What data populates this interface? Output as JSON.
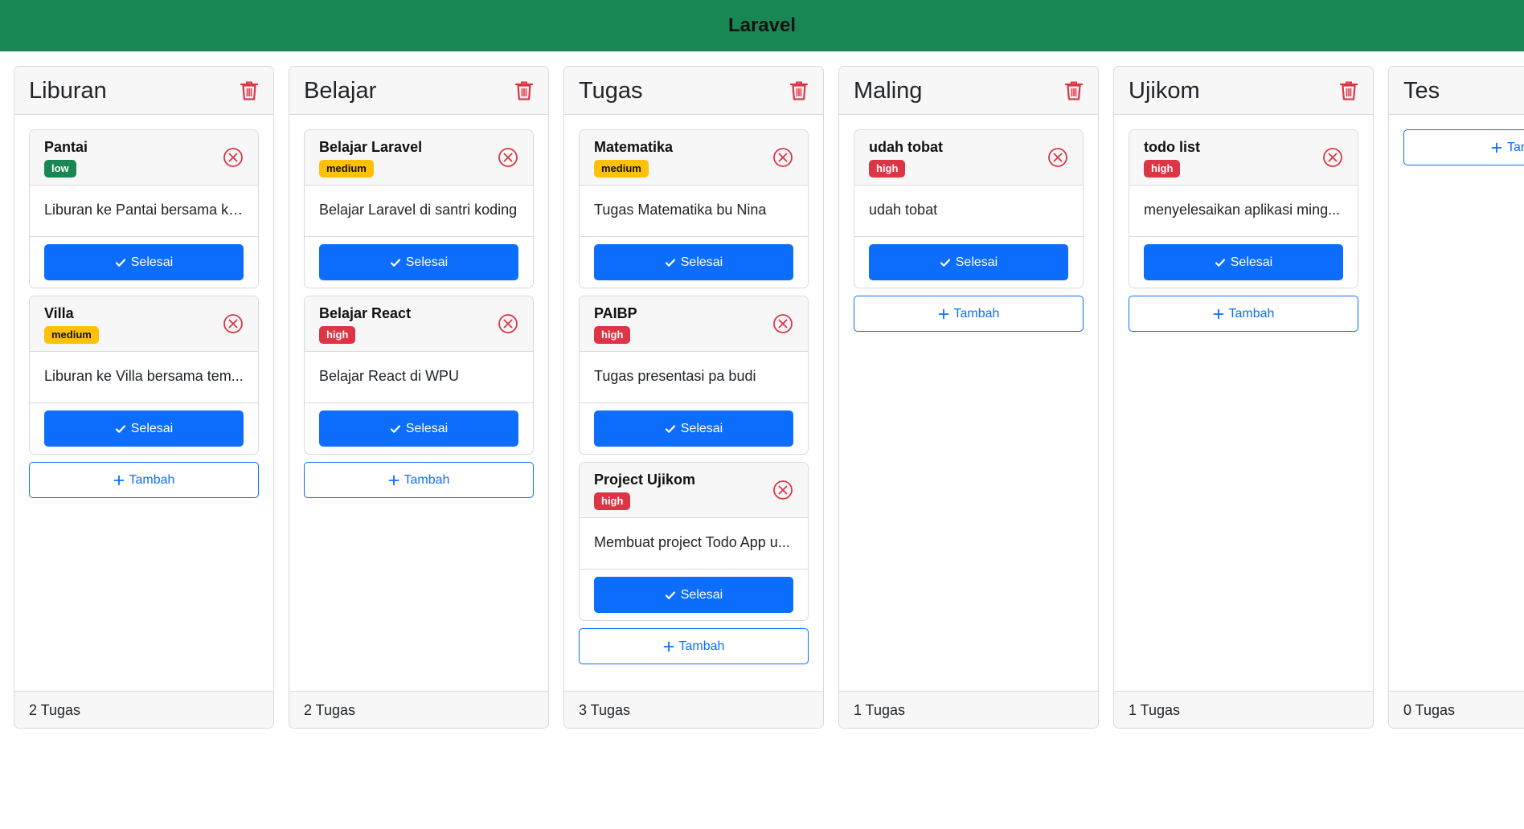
{
  "app": {
    "brand": "Laravel"
  },
  "columns": [
    {
      "title": "Liburan",
      "footer": "2 Tugas",
      "add_label": "Tambah",
      "cards": [
        {
          "title": "Pantai",
          "priority": "low",
          "description": "Liburan ke Pantai bersama ke...",
          "done_label": "Selesai"
        },
        {
          "title": "Villa",
          "priority": "medium",
          "description": "Liburan ke Villa bersama tem...",
          "done_label": "Selesai"
        }
      ]
    },
    {
      "title": "Belajar",
      "footer": "2 Tugas",
      "add_label": "Tambah",
      "cards": [
        {
          "title": "Belajar Laravel",
          "priority": "medium",
          "description": "Belajar Laravel di santri koding",
          "done_label": "Selesai"
        },
        {
          "title": "Belajar React",
          "priority": "high",
          "description": "Belajar React di WPU",
          "done_label": "Selesai"
        }
      ]
    },
    {
      "title": "Tugas",
      "footer": "3 Tugas",
      "add_label": "Tambah",
      "cards": [
        {
          "title": "Matematika",
          "priority": "medium",
          "description": "Tugas Matematika bu Nina",
          "done_label": "Selesai"
        },
        {
          "title": "PAIBP",
          "priority": "high",
          "description": "Tugas presentasi pa budi",
          "done_label": "Selesai"
        },
        {
          "title": "Project Ujikom",
          "priority": "high",
          "description": "Membuat project Todo App u...",
          "done_label": "Selesai"
        }
      ]
    },
    {
      "title": "Maling",
      "footer": "1 Tugas",
      "add_label": "Tambah",
      "cards": [
        {
          "title": "udah tobat",
          "priority": "high",
          "description": "udah tobat",
          "done_label": "Selesai"
        }
      ]
    },
    {
      "title": "Ujikom",
      "footer": "1 Tugas",
      "add_label": "Tambah",
      "cards": [
        {
          "title": "todo list",
          "priority": "high",
          "description": "menyelesaikan aplikasi ming...",
          "done_label": "Selesai"
        }
      ]
    },
    {
      "title": "Tes",
      "footer": "0 Tugas",
      "add_label": "Tambah",
      "cards": []
    }
  ],
  "colors": {
    "navbar": "#198754",
    "primary": "#0d6efd",
    "danger": "#dc3545",
    "warning": "#ffc107",
    "success": "#198754"
  },
  "icons": {
    "delete_column": "trash-icon",
    "delete_card": "x-circle-icon",
    "done": "check-icon",
    "add": "plus-icon"
  }
}
